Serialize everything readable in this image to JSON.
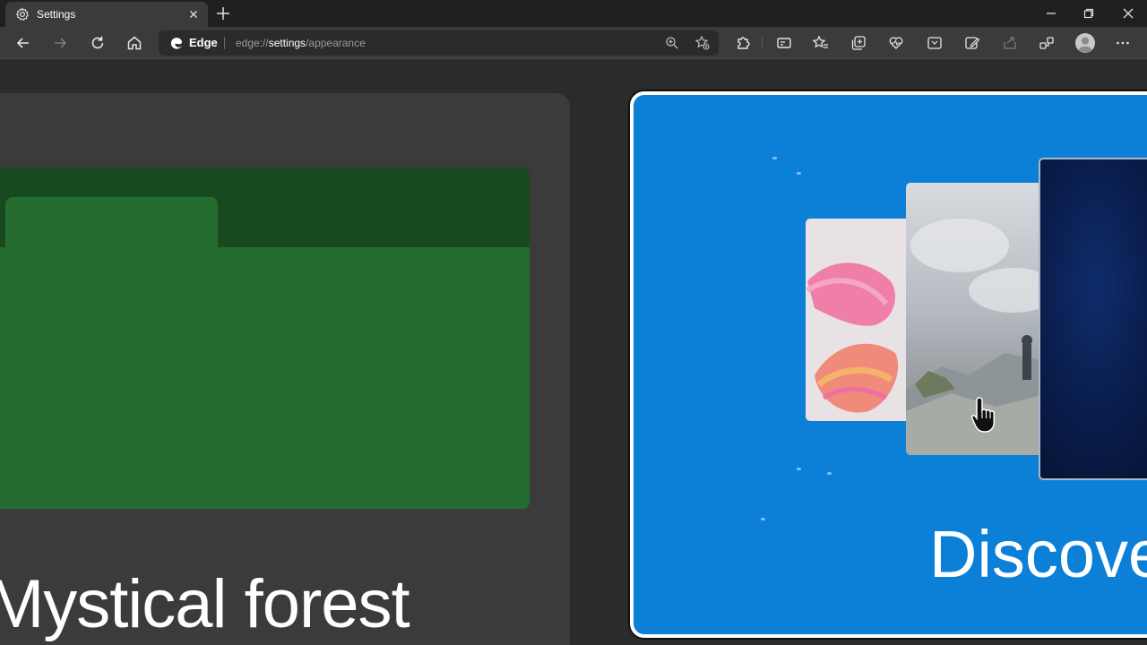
{
  "tab": {
    "title": "Settings"
  },
  "address_bar": {
    "site_label": "Edge",
    "url_prefix": "edge://",
    "url_highlight": "settings",
    "url_suffix": "/appearance"
  },
  "themes": {
    "left_card": {
      "title": "Mystical forest"
    },
    "right_card": {
      "title": "Discove"
    }
  },
  "colors": {
    "forest_dark": "#184a20",
    "forest_green": "#256c30",
    "discover_blue": "#0b80d6",
    "tab_bg": "#3b3b3b",
    "frame_bg": "#202020"
  },
  "icons": {
    "tab": "gear-icon",
    "toolbar": [
      "back-icon",
      "forward-icon",
      "refresh-icon",
      "home-icon"
    ],
    "address": [
      "zoom-icon",
      "add-favorite-icon"
    ],
    "extras": [
      "extensions-icon",
      "cast-icon",
      "favorites-icon",
      "collections-icon",
      "health-icon",
      "web-capture-icon",
      "edit-icon",
      "share-icon",
      "performance-icon",
      "profile-icon",
      "more-icon"
    ]
  }
}
